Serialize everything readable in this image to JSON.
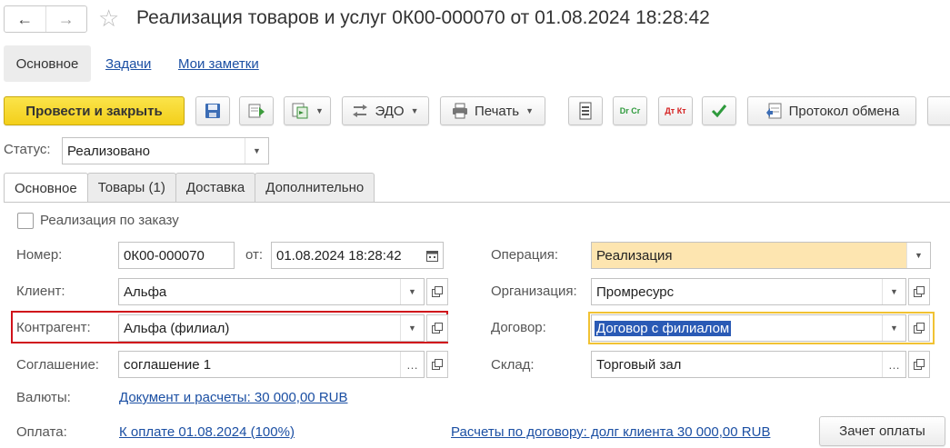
{
  "window": {
    "title": "Реализация товаров и услуг 0К00-000070 от 01.08.2024 18:28:42",
    "back_icon": "←",
    "forward_icon": "→",
    "favorite_icon": "☆"
  },
  "top_nav": {
    "items": [
      "Основное",
      "Задачи",
      "Мои заметки"
    ]
  },
  "toolbar": {
    "post_close": "Провести и закрыть",
    "edo": "ЭДО",
    "print": "Печать",
    "exchange_protocol": "Протокол обмена",
    "dr_cr": "Dr Cr",
    "dt_kt": "Дт Кт",
    "colors": {
      "accent": "#f5d21f",
      "link": "#1b4fa3",
      "green": "#2e9a3c",
      "red": "#d41c1c"
    }
  },
  "status": {
    "label": "Статус:",
    "value": "Реализовано"
  },
  "tabs": [
    "Основное",
    "Товары (1)",
    "Доставка",
    "Дополнительно"
  ],
  "form": {
    "by_order": {
      "label": "Реализация по заказу",
      "checked": false
    },
    "number": {
      "label": "Номер:",
      "value": "0К00-000070"
    },
    "date": {
      "label": "от:",
      "value": "01.08.2024 18:28:42"
    },
    "client": {
      "label": "Клиент:",
      "value": "Альфа"
    },
    "contractor": {
      "label": "Контрагент:",
      "value": "Альфа (филиал)"
    },
    "agreement": {
      "label": "Соглашение:",
      "value": "соглашение 1"
    },
    "currency": {
      "label": "Валюты:",
      "link": "Документ и расчеты: 30 000,00 RUB"
    },
    "payment": {
      "label": "Оплата:",
      "link": "К оплате 01.08.2024 (100%)"
    },
    "operation": {
      "label": "Операция:",
      "value": "Реализация"
    },
    "organization": {
      "label": "Организация:",
      "value": "Промресурс"
    },
    "contract": {
      "label": "Договор:",
      "value": "Договор с филиалом"
    },
    "warehouse": {
      "label": "Склад:",
      "value": "Торговый зал"
    },
    "contract_settlements": "Расчеты по договору: долг клиента 30 000,00 RUB",
    "payment_offset": "Зачет оплаты"
  }
}
